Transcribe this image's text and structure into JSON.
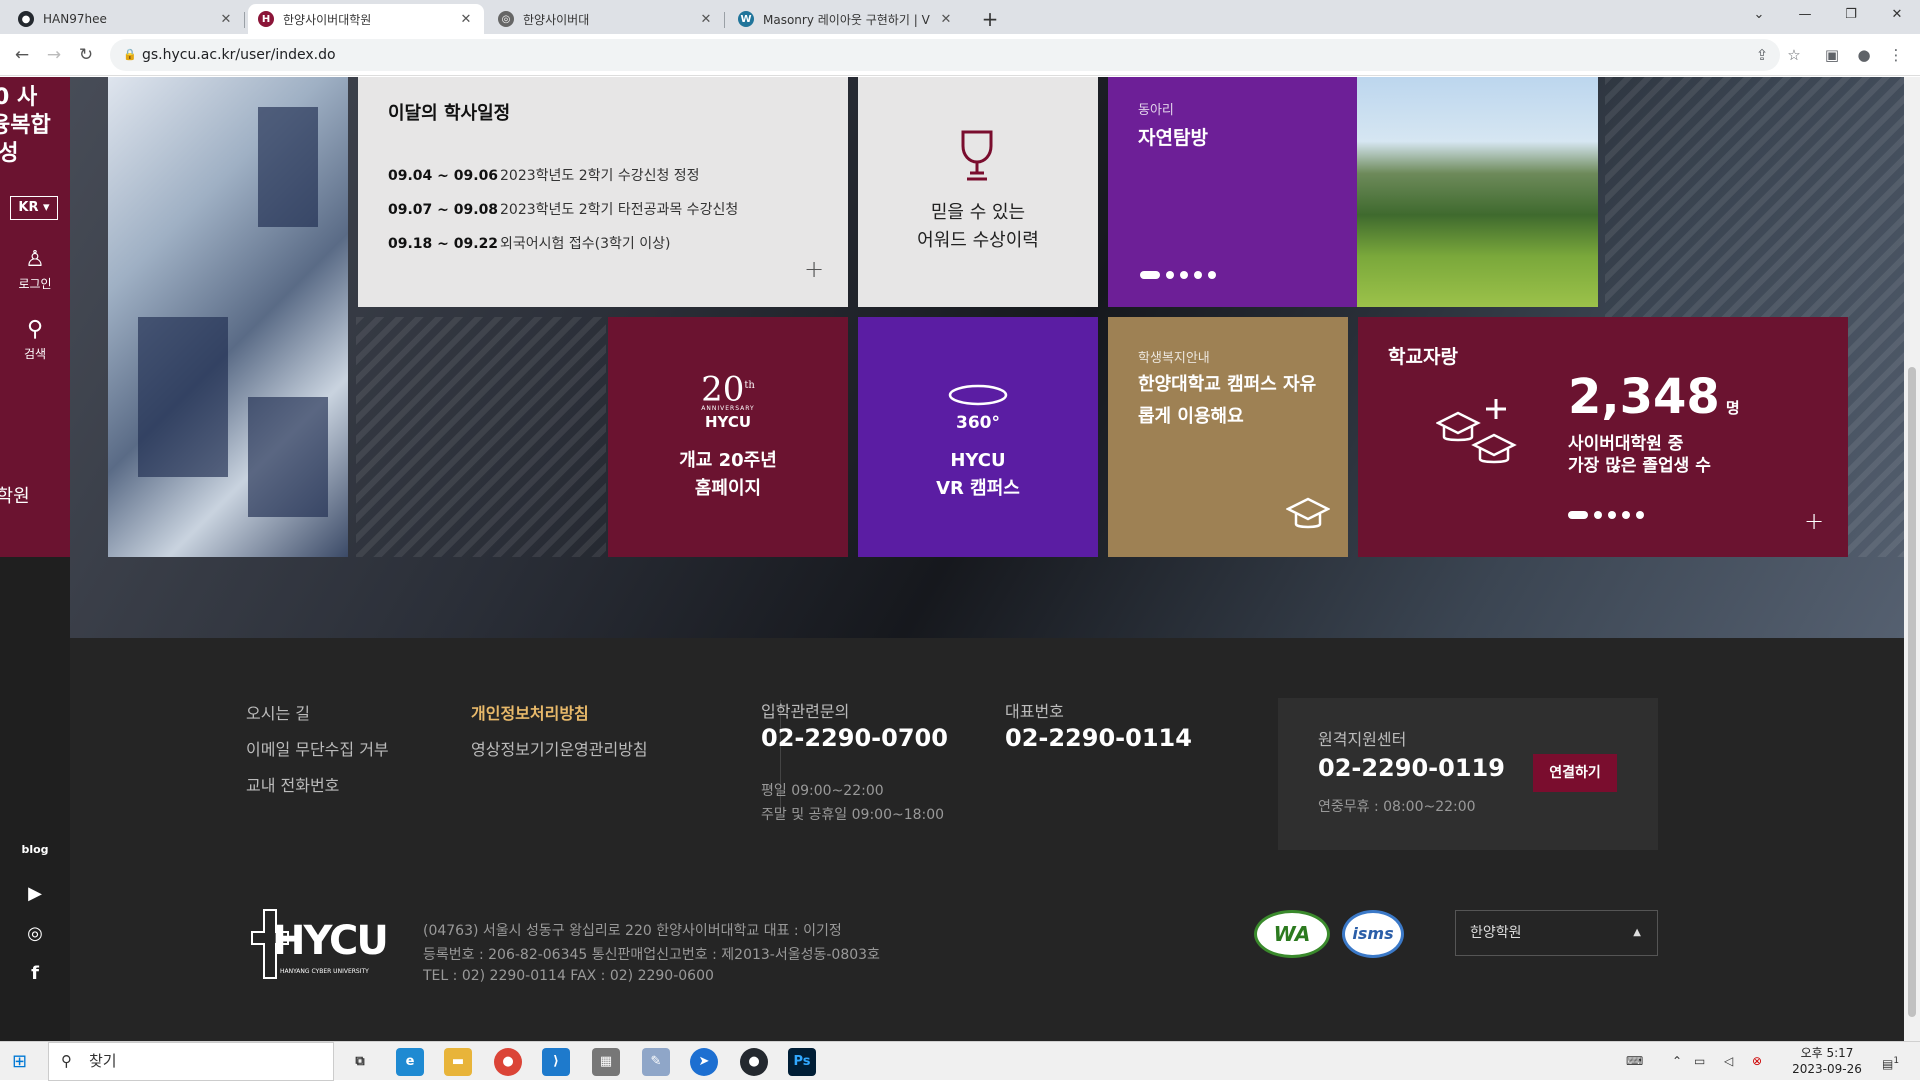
{
  "browser": {
    "tabs": [
      {
        "title": "HAN97hee",
        "favicon": "github-icon"
      },
      {
        "title": "한양사이버대학원",
        "favicon": "hycu-icon"
      },
      {
        "title": "한양사이버대",
        "favicon": "globe-icon"
      },
      {
        "title": "Masonry 레이아웃 구현하기 | V",
        "favicon": "wordpress-icon"
      }
    ],
    "url": "gs.hycu.ac.kr/user/index.do"
  },
  "sidebar": {
    "cut_text_1": "0 사",
    "cut_text_2": "융복합",
    "cut_text_3": "양성",
    "cut_text_4": "대학원",
    "language": "KR",
    "login_label": "로그인",
    "search_label": "검색",
    "social": [
      "blog",
      "youtube",
      "instagram",
      "facebook"
    ]
  },
  "schedule": {
    "title": "이달의 학사일정",
    "items": [
      {
        "date": "09.04 ~ 09.06",
        "text": "2023학년도 2학기 수강신청 정정"
      },
      {
        "date": "09.07 ~ 09.08",
        "text": "2023학년도 2학기 타전공과목 수강신청"
      },
      {
        "date": "09.18 ~ 09.22",
        "text": "외국어시험 접수(3학기 이상)"
      }
    ],
    "more": "+"
  },
  "award": {
    "line1": "믿을 수 있는",
    "line2": "어워드 수상이력"
  },
  "club": {
    "category": "동아리",
    "title": "자연탐방"
  },
  "anniversary": {
    "badge_num": "20",
    "badge_sup": "th",
    "badge_small": "ANNIVERSARY",
    "badge_brand": "HYCU",
    "line1": "개교 20주년",
    "line2": "홈페이지"
  },
  "vr": {
    "badge": "360°",
    "line1": "HYCU",
    "line2": "VR 캠퍼스"
  },
  "welfare": {
    "category": "학생복지안내",
    "line1": "한양대학교 캠퍼스 자유",
    "line2": "롭게 이용해요"
  },
  "pride": {
    "title": "학교자랑",
    "number": "2,348",
    "unit": "명",
    "line1": "사이버대학원 중",
    "line2": "가장 많은 졸업생 수",
    "more": "+"
  },
  "footer": {
    "links_col1": [
      "오시는 길",
      "이메일 무단수집 거부",
      "교내 전화번호"
    ],
    "links_col2": [
      "개인정보처리방침",
      "영상정보기기운영관리방침"
    ],
    "admission": {
      "label": "입학관련문의",
      "number": "02-2290-0700",
      "hours1": "평일 09:00~22:00",
      "hours2": "주말 및 공휴일 09:00~18:00"
    },
    "main": {
      "label": "대표번호",
      "number": "02-2290-0114"
    },
    "remote": {
      "label": "원격지원센터",
      "number": "02-2290-0119",
      "hours": "연중무휴 : 08:00~22:00",
      "button": "연결하기"
    },
    "logo_text": "HYCU",
    "logo_sub": "HANYANG CYBER UNIVERSITY",
    "address1": "(04763) 서울시 성동구 왕십리로 220 한양사이버대학교  대표 : 이기정",
    "address2": "등록번호 : 206-82-06345  통신판매업신고번호 : 제2013-서울성동-0803호",
    "address3": "TEL : 02) 2290-0114  FAX : 02) 2290-0600",
    "badge1": "WA",
    "badge2": "isms",
    "family_site": "한양학원"
  },
  "taskbar": {
    "search_placeholder": "찾기",
    "time": "오후 5:17",
    "date": "2023-09-26",
    "notif_count": "1"
  },
  "colors": {
    "wine": "#6b1330",
    "purple": "#5b1da3",
    "gold": "#9e8154",
    "accent": "#e8b96a"
  }
}
